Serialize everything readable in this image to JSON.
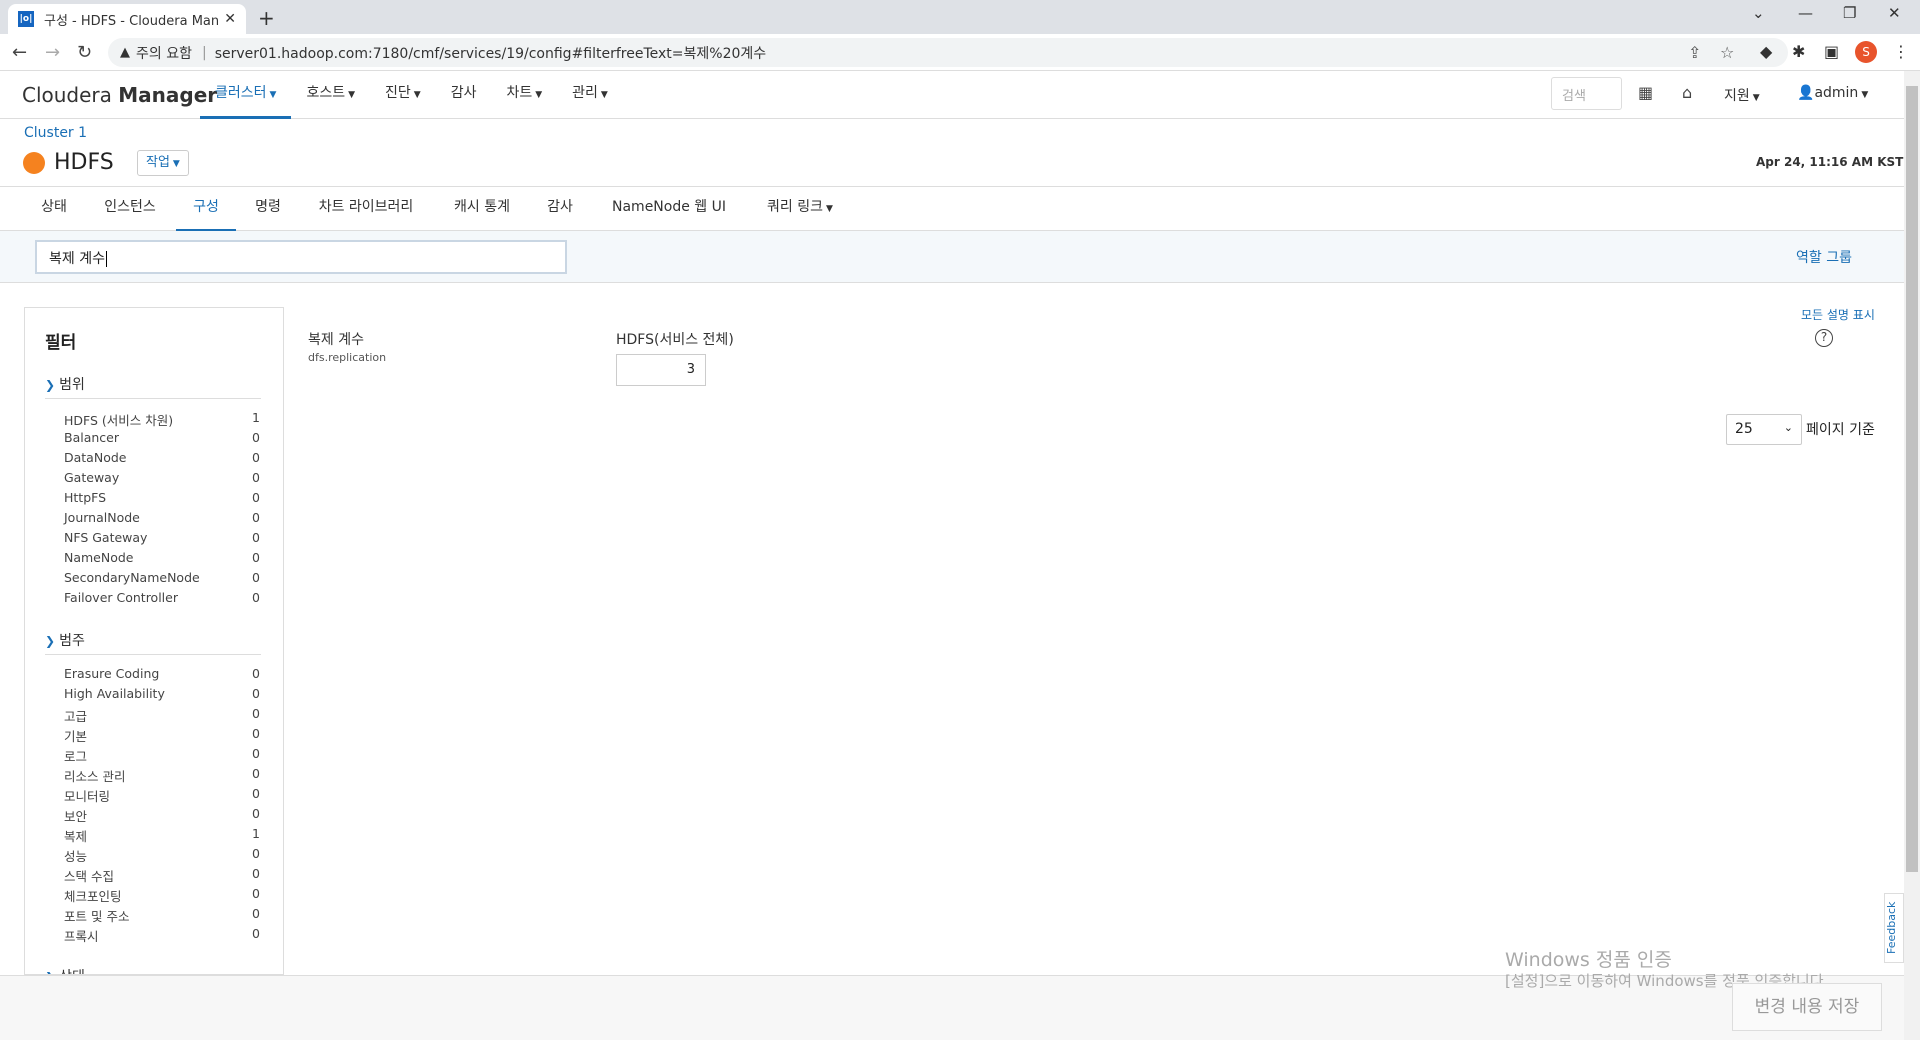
{
  "browser": {
    "tab_title": "구성 - HDFS - Cloudera Manag",
    "favicon_text": "|o|",
    "address_warning": "주의 요함",
    "url": "server01.hadoop.com:7180/cmf/services/19/config#filterfreeText=복제%20계수",
    "profile_initial": "S"
  },
  "header": {
    "logo_light": "Cloudera",
    "logo_bold": "Manager",
    "nav": [
      "클러스터",
      "호스트",
      "진단",
      "감사",
      "차트",
      "관리"
    ],
    "search_placeholder": "검색",
    "support": "지원",
    "user": "admin"
  },
  "service": {
    "breadcrumb": "Cluster 1",
    "name": "HDFS",
    "actions": "작업",
    "timestamp": "Apr 24, 11:16 AM KST",
    "status_color": "#f5821f"
  },
  "subtabs": [
    "상태",
    "인스턴스",
    "구성",
    "명령",
    "차트 라이브러리",
    "캐시 통계",
    "감사",
    "NameNode 웹 UI",
    "쿼리 링크"
  ],
  "filterbar": {
    "search_value": "복제 계수",
    "role_groups": "역할 그룹"
  },
  "sidebar": {
    "title": "필터",
    "groups": [
      {
        "label": "범위",
        "items": [
          {
            "name": "HDFS (서비스 차원)",
            "count": "1"
          },
          {
            "name": "Balancer",
            "count": "0"
          },
          {
            "name": "DataNode",
            "count": "0"
          },
          {
            "name": "Gateway",
            "count": "0"
          },
          {
            "name": "HttpFS",
            "count": "0"
          },
          {
            "name": "JournalNode",
            "count": "0"
          },
          {
            "name": "NFS Gateway",
            "count": "0"
          },
          {
            "name": "NameNode",
            "count": "0"
          },
          {
            "name": "SecondaryNameNode",
            "count": "0"
          },
          {
            "name": "Failover Controller",
            "count": "0"
          }
        ]
      },
      {
        "label": "범주",
        "items": [
          {
            "name": "Erasure Coding",
            "count": "0"
          },
          {
            "name": "High Availability",
            "count": "0"
          },
          {
            "name": "고급",
            "count": "0"
          },
          {
            "name": "기본",
            "count": "0"
          },
          {
            "name": "로그",
            "count": "0"
          },
          {
            "name": "리소스 관리",
            "count": "0"
          },
          {
            "name": "모니터링",
            "count": "0"
          },
          {
            "name": "보안",
            "count": "0"
          },
          {
            "name": "복제",
            "count": "1"
          },
          {
            "name": "성능",
            "count": "0"
          },
          {
            "name": "스택 수집",
            "count": "0"
          },
          {
            "name": "체크포인팅",
            "count": "0"
          },
          {
            "name": "포트 및 주소",
            "count": "0"
          },
          {
            "name": "프록시",
            "count": "0"
          }
        ]
      },
      {
        "label": "상태",
        "items": []
      }
    ]
  },
  "config": {
    "show_all_desc": "모든 설명 표시",
    "help": "?",
    "property_name": "복제 계수",
    "property_key": "dfs.replication",
    "scope": "HDFS(서비스 전체)",
    "value": "3",
    "per_page_value": "25",
    "per_page_label": "페이지 기준"
  },
  "footer": {
    "save": "변경 내용 저장",
    "feedback": "Feedback"
  },
  "watermark": {
    "line1": "Windows 정품 인증",
    "line2": "[설정]으로 이동하여 Windows를 정품 인증합니다."
  }
}
